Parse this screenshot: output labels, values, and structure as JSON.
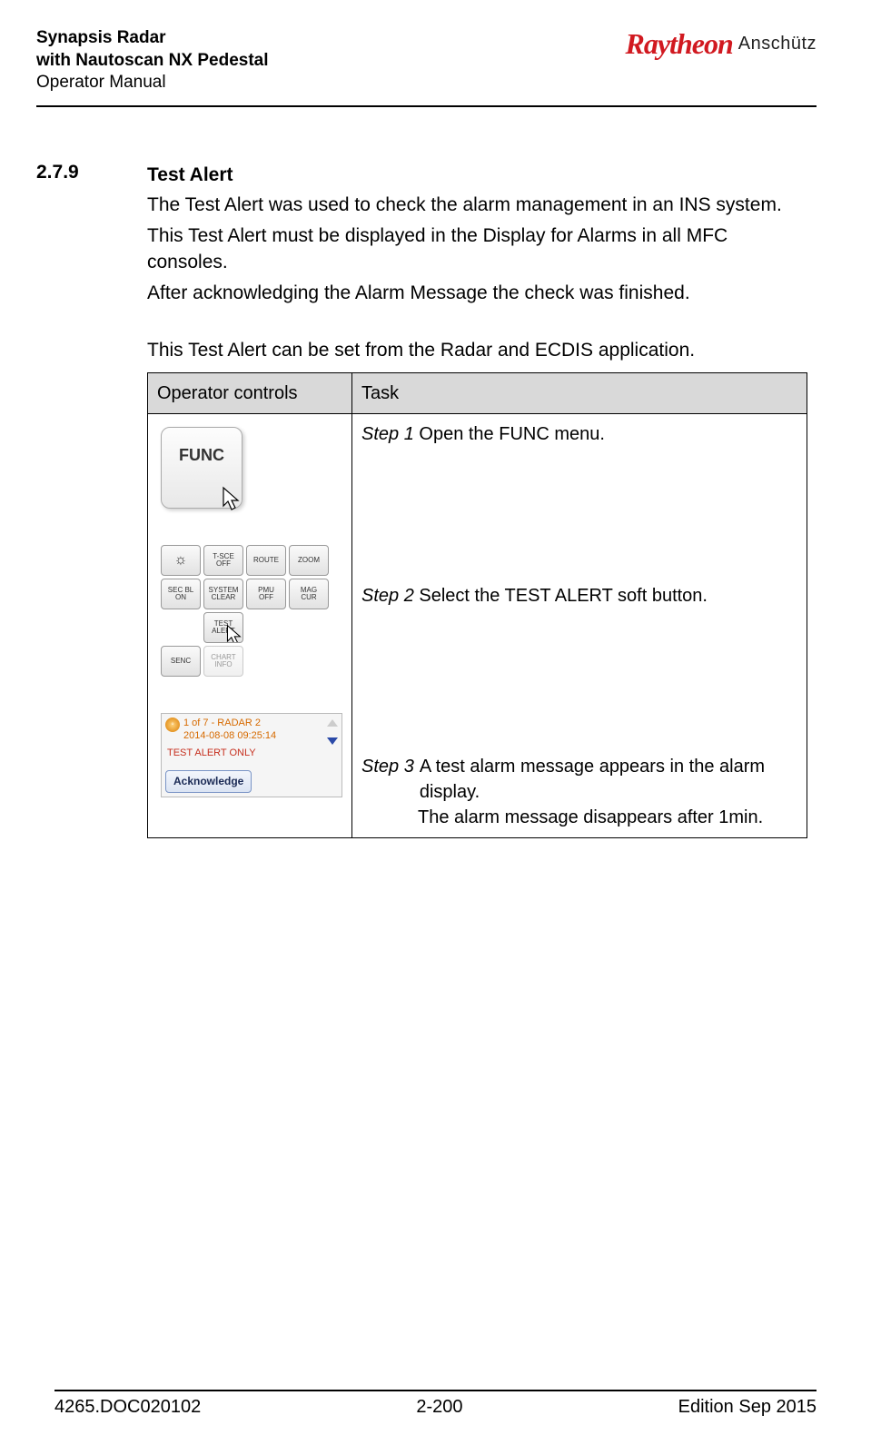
{
  "header": {
    "title_line1": "Synapsis Radar",
    "title_line2": "with Nautoscan NX Pedestal",
    "subtitle": "Operator Manual",
    "logo_brand": "Raytheon",
    "logo_sub": "Anschütz"
  },
  "section": {
    "number": "2.7.9",
    "heading": "Test Alert",
    "para1": "The Test Alert was used to check the alarm management in an INS system.",
    "para2": "This Test Alert must be displayed in the Display for Alarms in all MFC consoles.",
    "para3": "After acknowledging the Alarm Message the check was finished.",
    "para4": "This Test Alert can be set from the Radar and ECDIS application."
  },
  "table": {
    "col1": "Operator controls",
    "col2": "Task",
    "func_label": "FUNC",
    "softbuttons": {
      "r1c1": "☼",
      "r1c2a": "T-SCE",
      "r1c2b": "OFF",
      "r1c3": "ROUTE",
      "r1c4": "ZOOM",
      "r2c1a": "SEC BL",
      "r2c1b": "ON",
      "r2c2a": "SYSTEM",
      "r2c2b": "CLEAR",
      "r2c3a": "PMU",
      "r2c3b": "OFF",
      "r2c4a": "MAG",
      "r2c4b": "CUR",
      "r3c2a": "TEST",
      "r3c2b": "ALERT",
      "r4c1": "SENC",
      "r4c2a": "CHART",
      "r4c2b": "INFO"
    },
    "alarm": {
      "count_line": "1 of 7 - RADAR 2",
      "timestamp": "2014-08-08 09:25:14",
      "message": "TEST ALERT ONLY",
      "ack": "Acknowledge"
    },
    "step1_label": "Step 1",
    "step1_text": " Open the FUNC menu.",
    "step2_label": "Step 2",
    "step2_text": " Select the TEST ALERT soft button.",
    "step3_label": "Step 3",
    "step3_text_a": "A test alarm message appears in the alarm display.",
    "step3_text_b": "The alarm message disappears after 1min."
  },
  "footer": {
    "left": "4265.DOC020102",
    "center": "2-200",
    "right": "Edition Sep 2015"
  }
}
